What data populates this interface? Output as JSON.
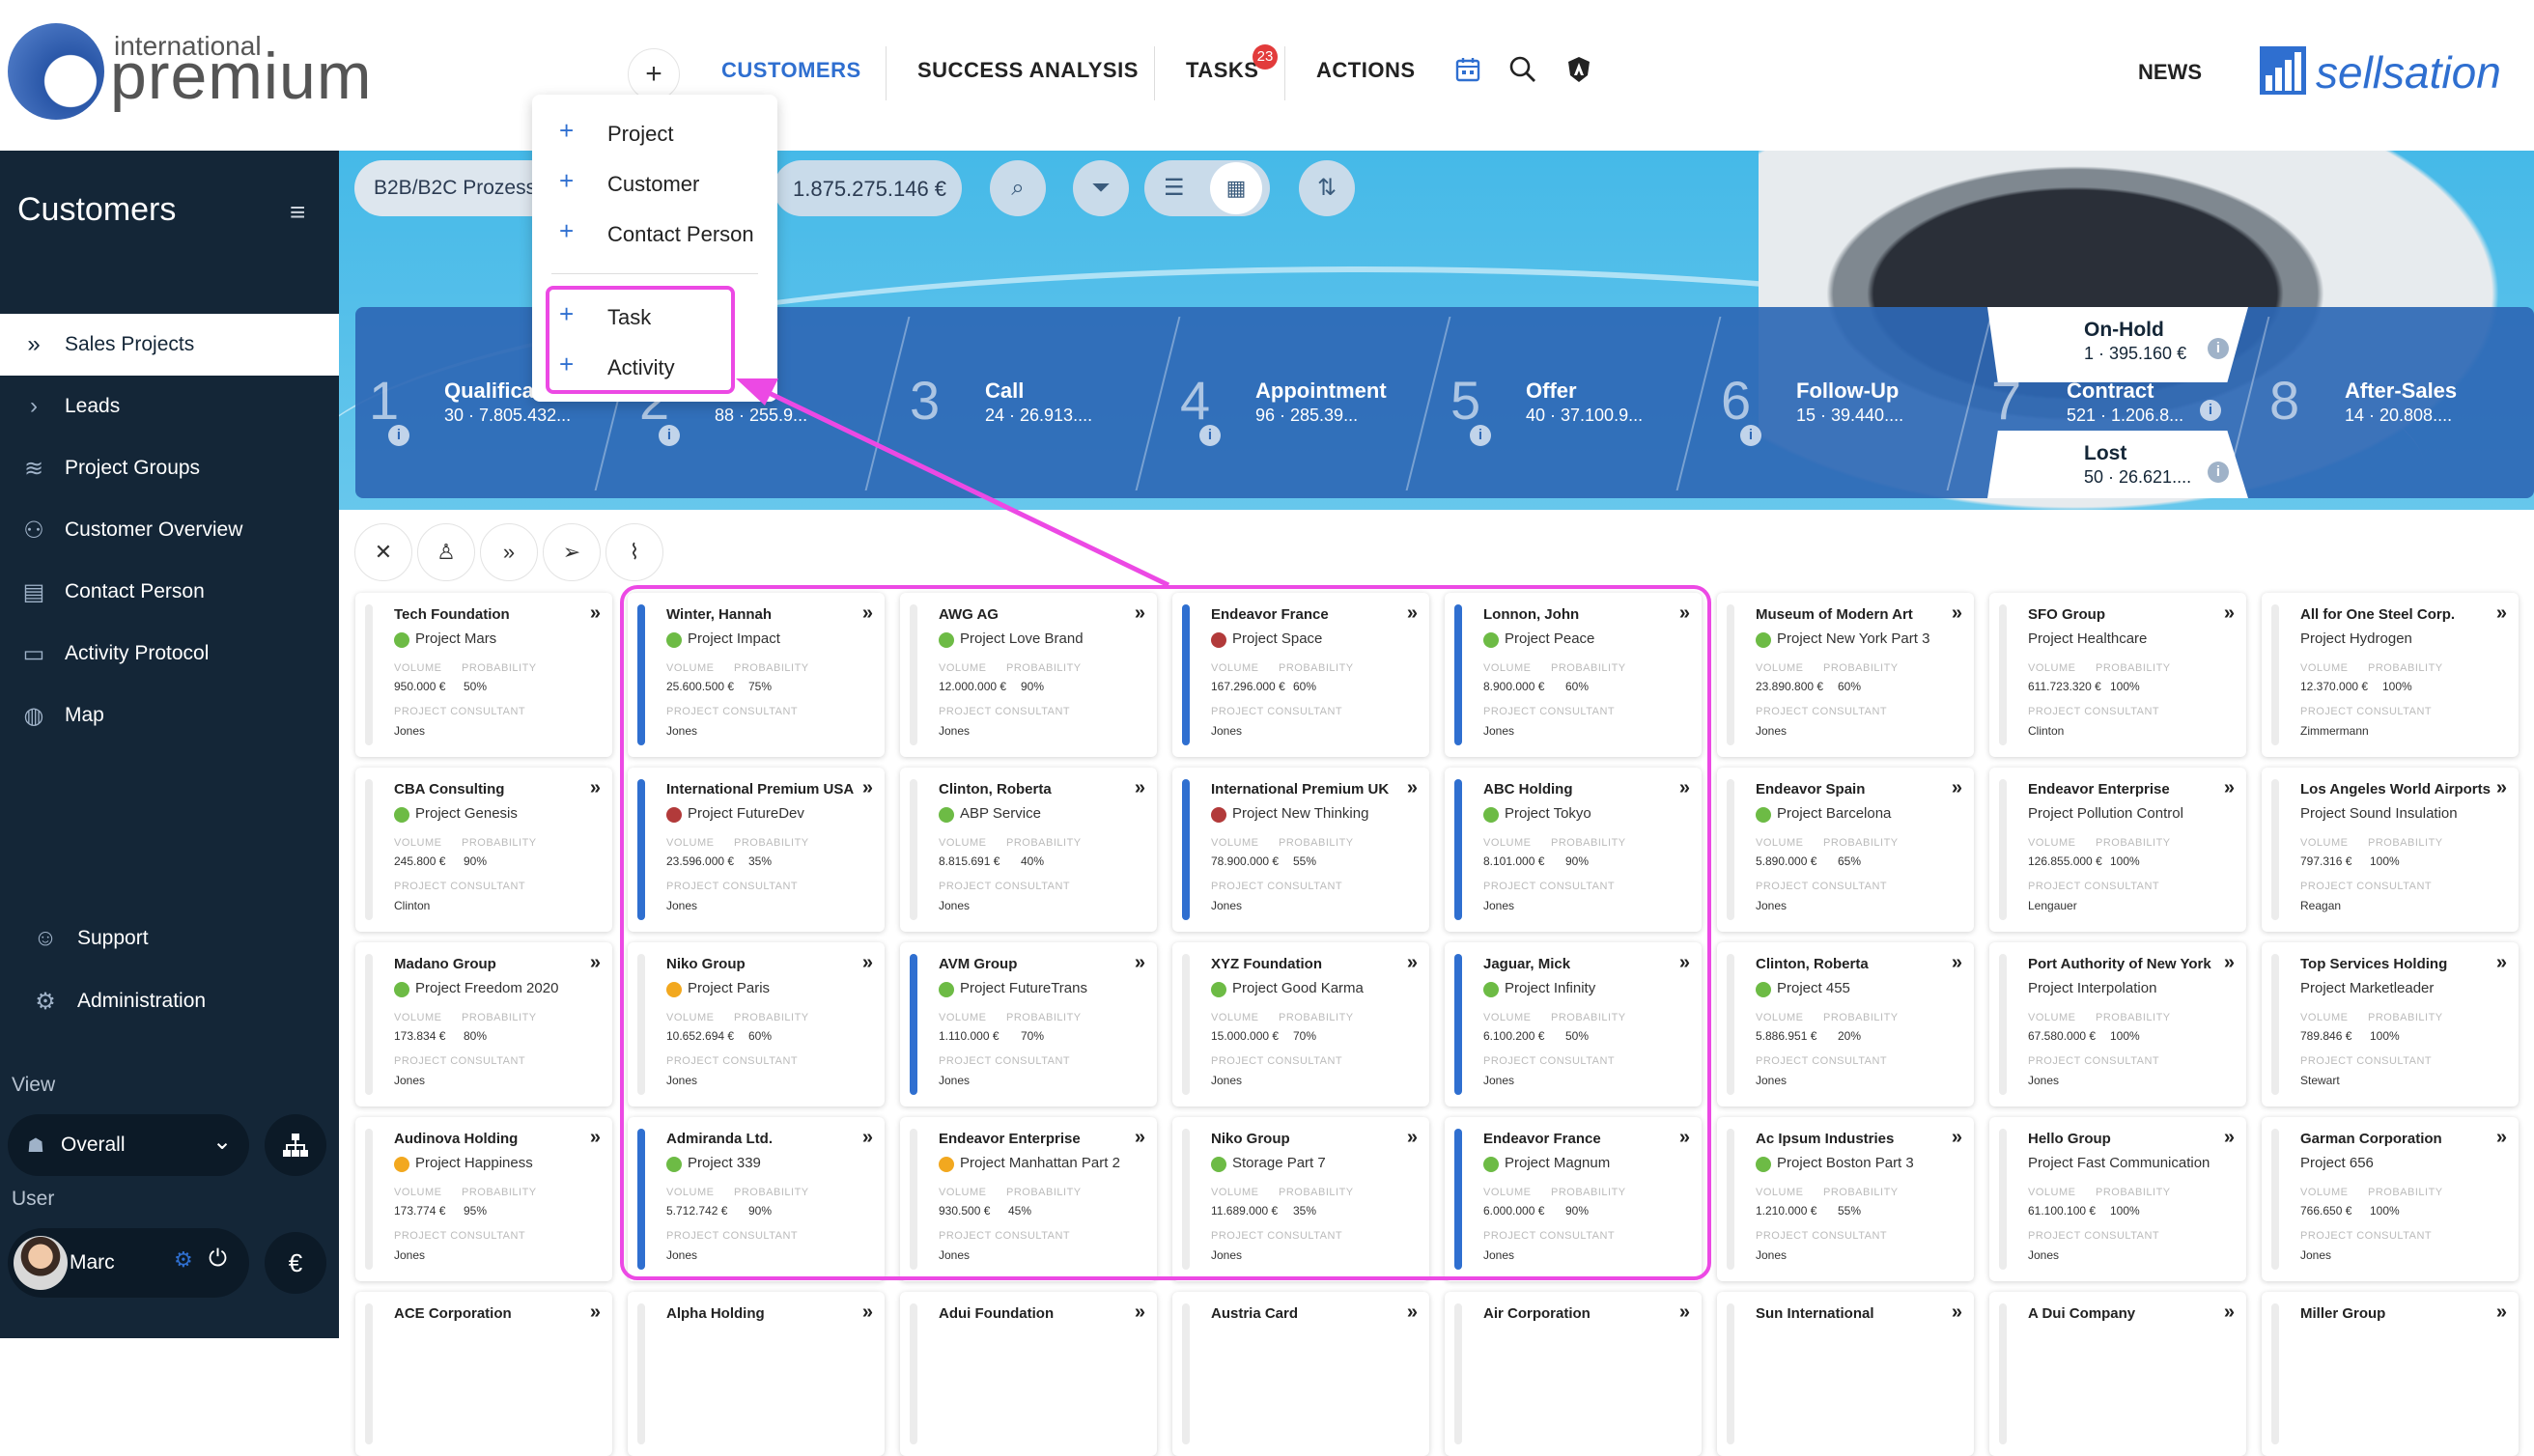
{
  "brand": {
    "small": "international",
    "big": "premium"
  },
  "topnav": {
    "plus": "+",
    "items": [
      "CUSTOMERS",
      "SUCCESS ANALYSIS",
      "TASKS",
      "ACTIONS"
    ],
    "tasks_badge": "23",
    "news": "NEWS",
    "sellsation": "sellsation"
  },
  "sidebar": {
    "title": "Customers",
    "menu_icon": "≡",
    "items": [
      {
        "label": "Sales Projects",
        "icon": "double-chevron-icon",
        "glyph": "»"
      },
      {
        "label": "Leads",
        "icon": "chevron-right-icon",
        "glyph": "›"
      },
      {
        "label": "Project Groups",
        "icon": "layers-icon",
        "glyph": "≋"
      },
      {
        "label": "Customer Overview",
        "icon": "users-icon",
        "glyph": "⚇"
      },
      {
        "label": "Contact Person",
        "icon": "contact-card-icon",
        "glyph": "▤"
      },
      {
        "label": "Activity Protocol",
        "icon": "comment-icon",
        "glyph": "▭"
      },
      {
        "label": "Map",
        "icon": "globe-icon",
        "glyph": "◍"
      }
    ],
    "support": "Support",
    "administration": "Administration",
    "view_label": "View",
    "view_value": "Overall",
    "user_label": "User",
    "user_name": "Marc",
    "currency": "€"
  },
  "toolbar": {
    "filter_pill": "B2B/B2C Prozess",
    "total": "1.875.275.146 €"
  },
  "pipeline": [
    {
      "num": "1",
      "name": "Qualificat",
      "value": "30 ·  7.805.432..."
    },
    {
      "num": "2",
      "name": "",
      "value": "88 ·  255.9..."
    },
    {
      "num": "3",
      "name": "Call",
      "value": "24 ·  26.913...."
    },
    {
      "num": "4",
      "name": "Appointment",
      "value": "96 ·  285.39..."
    },
    {
      "num": "5",
      "name": "Offer",
      "value": "40 ·  37.100.9..."
    },
    {
      "num": "6",
      "name": "Follow-Up",
      "value": "15 ·  39.440...."
    },
    {
      "num": "7",
      "name": "Contract",
      "value": "521 ·  1.206.8..."
    },
    {
      "num": "8",
      "name": "After-Sales",
      "value": "14 ·  20.808...."
    }
  ],
  "on_hold": {
    "name": "On-Hold",
    "value": "1 ·  395.160 €"
  },
  "lost": {
    "name": "Lost",
    "value": "50 ·  26.621...."
  },
  "dropdown": {
    "items": [
      "Project",
      "Customer",
      "Contact Person",
      "Task",
      "Activity"
    ]
  },
  "card_labels": {
    "volume": "VOLUME",
    "probability": "PROBABILITY",
    "consultant": "PROJECT CONSULTANT"
  },
  "colors": {
    "green": "#6dbb45",
    "red": "#b23a3a",
    "orange": "#f2a81f",
    "blue": "#2f6fd0",
    "highlight": "#ec49e4"
  },
  "cards": [
    [
      {
        "t": "Tech Foundation",
        "p": "Project Mars",
        "d": "green",
        "v": "950.000 €",
        "pr": "50%",
        "c": "Jones",
        "bar": "grey"
      },
      {
        "t": "Winter, Hannah",
        "p": "Project Impact",
        "d": "green",
        "v": "25.600.500 €",
        "pr": "75%",
        "c": "Jones",
        "bar": "blue"
      },
      {
        "t": "AWG AG",
        "p": "Project Love Brand",
        "d": "green",
        "v": "12.000.000 €",
        "pr": "90%",
        "c": "Jones",
        "bar": "grey"
      },
      {
        "t": "Endeavor France",
        "p": "Project Space",
        "d": "red",
        "v": "167.296.000 €",
        "pr": "60%",
        "c": "Jones",
        "bar": "blue"
      },
      {
        "t": "Lonnon, John",
        "p": "Project Peace",
        "d": "green",
        "v": "8.900.000 €",
        "pr": "60%",
        "c": "Jones",
        "bar": "blue"
      },
      {
        "t": "Museum of Modern Art",
        "p": "Project New York Part 3",
        "d": "green",
        "v": "23.890.800 €",
        "pr": "60%",
        "c": "Jones",
        "bar": "grey"
      },
      {
        "t": "SFO Group",
        "p": "Project Healthcare",
        "d": "",
        "v": "611.723.320 €",
        "pr": "100%",
        "c": "Clinton",
        "bar": "grey"
      },
      {
        "t": "All for One Steel Corp.",
        "p": "Project Hydrogen",
        "d": "",
        "v": "12.370.000 €",
        "pr": "100%",
        "c": "Zimmermann",
        "bar": "grey"
      }
    ],
    [
      {
        "t": "CBA Consulting",
        "p": "Project Genesis",
        "d": "green",
        "v": "245.800 €",
        "pr": "90%",
        "c": "Clinton",
        "bar": "grey"
      },
      {
        "t": "International Premium USA",
        "p": "Project FutureDev",
        "d": "red",
        "v": "23.596.000 €",
        "pr": "35%",
        "c": "Jones",
        "bar": "blue"
      },
      {
        "t": "Clinton, Roberta",
        "p": "ABP Service",
        "d": "green",
        "v": "8.815.691 €",
        "pr": "40%",
        "c": "Jones",
        "bar": "grey"
      },
      {
        "t": "International Premium UK",
        "p": "Project New Thinking",
        "d": "red",
        "v": "78.900.000 €",
        "pr": "55%",
        "c": "Jones",
        "bar": "blue"
      },
      {
        "t": "ABC Holding",
        "p": "Project Tokyo",
        "d": "green",
        "v": "8.101.000 €",
        "pr": "90%",
        "c": "Jones",
        "bar": "blue"
      },
      {
        "t": "Endeavor Spain",
        "p": "Project Barcelona",
        "d": "green",
        "v": "5.890.000 €",
        "pr": "65%",
        "c": "Jones",
        "bar": "grey"
      },
      {
        "t": "Endeavor Enterprise",
        "p": "Project Pollution Control",
        "d": "",
        "v": "126.855.000 €",
        "pr": "100%",
        "c": "Lengauer",
        "bar": "grey"
      },
      {
        "t": "Los Angeles World Airports",
        "p": "Project Sound Insulation",
        "d": "",
        "v": "797.316 €",
        "pr": "100%",
        "c": "Reagan",
        "bar": "grey"
      }
    ],
    [
      {
        "t": "Madano Group",
        "p": "Project Freedom 2020",
        "d": "green",
        "v": "173.834 €",
        "pr": "80%",
        "c": "Jones",
        "bar": "grey"
      },
      {
        "t": "Niko Group",
        "p": "Project Paris",
        "d": "orange",
        "v": "10.652.694 €",
        "pr": "60%",
        "c": "Jones",
        "bar": "grey"
      },
      {
        "t": "AVM Group",
        "p": "Project FutureTrans",
        "d": "green",
        "v": "1.110.000 €",
        "pr": "70%",
        "c": "Jones",
        "bar": "blue"
      },
      {
        "t": "XYZ Foundation",
        "p": "Project Good Karma",
        "d": "green",
        "v": "15.000.000 €",
        "pr": "70%",
        "c": "Jones",
        "bar": "grey"
      },
      {
        "t": "Jaguar, Mick",
        "p": "Project Infinity",
        "d": "green",
        "v": "6.100.200 €",
        "pr": "50%",
        "c": "Jones",
        "bar": "blue"
      },
      {
        "t": "Clinton, Roberta",
        "p": "Project 455",
        "d": "green",
        "v": "5.886.951 €",
        "pr": "20%",
        "c": "Jones",
        "bar": "grey"
      },
      {
        "t": "Port Authority of New York",
        "p": "Project Interpolation",
        "d": "",
        "v": "67.580.000 €",
        "pr": "100%",
        "c": "Jones",
        "bar": "grey"
      },
      {
        "t": "Top Services Holding",
        "p": "Project Marketleader",
        "d": "",
        "v": "789.846 €",
        "pr": "100%",
        "c": "Stewart",
        "bar": "grey"
      }
    ],
    [
      {
        "t": "Audinova Holding",
        "p": "Project Happiness",
        "d": "orange",
        "v": "173.774 €",
        "pr": "95%",
        "c": "Jones",
        "bar": "grey"
      },
      {
        "t": "Admiranda Ltd.",
        "p": "Project 339",
        "d": "green",
        "v": "5.712.742 €",
        "pr": "90%",
        "c": "Jones",
        "bar": "blue"
      },
      {
        "t": "Endeavor Enterprise",
        "p": "Project Manhattan Part 2",
        "d": "orange",
        "v": "930.500 €",
        "pr": "45%",
        "c": "Jones",
        "bar": "grey"
      },
      {
        "t": "Niko Group",
        "p": "Storage Part 7",
        "d": "green",
        "v": "11.689.000 €",
        "pr": "35%",
        "c": "Jones",
        "bar": "grey"
      },
      {
        "t": "Endeavor France",
        "p": "Project Magnum",
        "d": "green",
        "v": "6.000.000 €",
        "pr": "90%",
        "c": "Jones",
        "bar": "blue"
      },
      {
        "t": "Ac Ipsum Industries",
        "p": "Project Boston Part 3",
        "d": "green",
        "v": "1.210.000 €",
        "pr": "55%",
        "c": "Jones",
        "bar": "grey"
      },
      {
        "t": "Hello Group",
        "p": "Project Fast Communication",
        "d": "",
        "v": "61.100.100 €",
        "pr": "100%",
        "c": "Jones",
        "bar": "grey"
      },
      {
        "t": "Garman Corporation",
        "p": "Project 656",
        "d": "",
        "v": "766.650 €",
        "pr": "100%",
        "c": "Jones",
        "bar": "grey"
      }
    ],
    [
      {
        "t": "ACE Corporation",
        "p": "",
        "d": "",
        "v": "",
        "pr": "",
        "c": "",
        "bar": "grey"
      },
      {
        "t": "Alpha Holding",
        "p": "",
        "d": "",
        "v": "",
        "pr": "",
        "c": "",
        "bar": "grey"
      },
      {
        "t": "Adui Foundation",
        "p": "",
        "d": "",
        "v": "",
        "pr": "",
        "c": "",
        "bar": "grey"
      },
      {
        "t": "Austria Card",
        "p": "",
        "d": "",
        "v": "",
        "pr": "",
        "c": "",
        "bar": "grey"
      },
      {
        "t": "Air Corporation",
        "p": "",
        "d": "",
        "v": "",
        "pr": "",
        "c": "",
        "bar": "grey"
      },
      {
        "t": "Sun International",
        "p": "",
        "d": "",
        "v": "",
        "pr": "",
        "c": "",
        "bar": "grey"
      },
      {
        "t": "A Dui Company",
        "p": "",
        "d": "",
        "v": "",
        "pr": "",
        "c": "",
        "bar": "grey"
      },
      {
        "t": "Miller Group",
        "p": "",
        "d": "",
        "v": "",
        "pr": "",
        "c": "",
        "bar": "grey"
      }
    ]
  ]
}
